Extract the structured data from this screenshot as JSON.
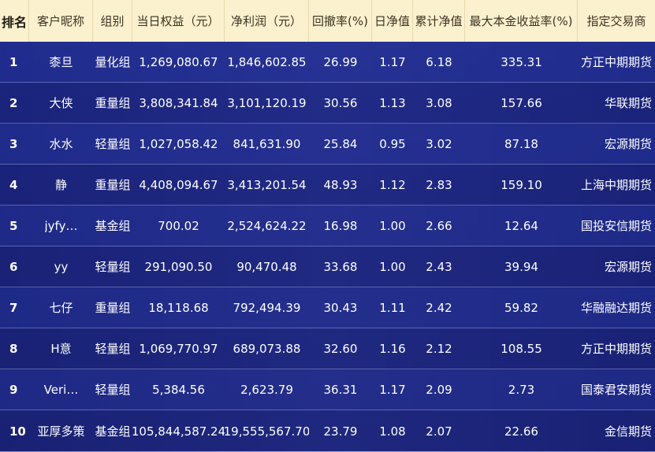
{
  "header": {
    "columns": [
      "排名",
      "客户昵称",
      "组别",
      "当日权益（元）",
      "净利润（元）",
      "回撤率(%)",
      "日净值",
      "累计净值",
      "最大本金收益率(%)",
      "指定交易商"
    ]
  },
  "rows": [
    {
      "rank": "1",
      "name": "桼旦",
      "group": "量化组",
      "equity": "1,269,080.67",
      "profit": "1,846,602.85",
      "drawdown": "26.99",
      "daily_nav": "1.17",
      "cum_nav": "6.18",
      "max_return": "335.31",
      "broker": "方正中期期货"
    },
    {
      "rank": "2",
      "name": "大侠",
      "group": "重量组",
      "equity": "3,808,341.84",
      "profit": "3,101,120.19",
      "drawdown": "30.56",
      "daily_nav": "1.13",
      "cum_nav": "3.08",
      "max_return": "157.66",
      "broker": "华联期货"
    },
    {
      "rank": "3",
      "name": "水水",
      "group": "轻量组",
      "equity": "1,027,058.42",
      "profit": "841,631.90",
      "drawdown": "25.84",
      "daily_nav": "0.95",
      "cum_nav": "3.02",
      "max_return": "87.18",
      "broker": "宏源期货"
    },
    {
      "rank": "4",
      "name": "静",
      "group": "重量组",
      "equity": "4,408,094.67",
      "profit": "3,413,201.54",
      "drawdown": "48.93",
      "daily_nav": "1.12",
      "cum_nav": "2.83",
      "max_return": "159.10",
      "broker": "上海中期期货"
    },
    {
      "rank": "5",
      "name": "jyfy…",
      "group": "基金组",
      "equity": "700.02",
      "profit": "2,524,624.22",
      "drawdown": "16.98",
      "daily_nav": "1.00",
      "cum_nav": "2.66",
      "max_return": "12.64",
      "broker": "国投安信期货"
    },
    {
      "rank": "6",
      "name": "yy",
      "group": "轻量组",
      "equity": "291,090.50",
      "profit": "90,470.48",
      "drawdown": "33.68",
      "daily_nav": "1.00",
      "cum_nav": "2.43",
      "max_return": "39.94",
      "broker": "宏源期货"
    },
    {
      "rank": "7",
      "name": "七仔",
      "group": "重量组",
      "equity": "18,118.68",
      "profit": "792,494.39",
      "drawdown": "30.43",
      "daily_nav": "1.11",
      "cum_nav": "2.42",
      "max_return": "59.82",
      "broker": "华融融达期货"
    },
    {
      "rank": "8",
      "name": "H意",
      "group": "轻量组",
      "equity": "1,069,770.97",
      "profit": "689,073.88",
      "drawdown": "32.60",
      "daily_nav": "1.16",
      "cum_nav": "2.12",
      "max_return": "108.55",
      "broker": "方正中期期货"
    },
    {
      "rank": "9",
      "name": "Veri…",
      "group": "轻量组",
      "equity": "5,384.56",
      "profit": "2,623.79",
      "drawdown": "36.31",
      "daily_nav": "1.17",
      "cum_nav": "2.09",
      "max_return": "2.73",
      "broker": "国泰君安期货"
    },
    {
      "rank": "10",
      "name": "亚厚多策",
      "group": "基金组",
      "equity": "105,844,587.24",
      "profit": "19,555,567.70",
      "drawdown": "23.79",
      "daily_nav": "1.08",
      "cum_nav": "2.07",
      "max_return": "22.66",
      "broker": "金信期货"
    }
  ]
}
